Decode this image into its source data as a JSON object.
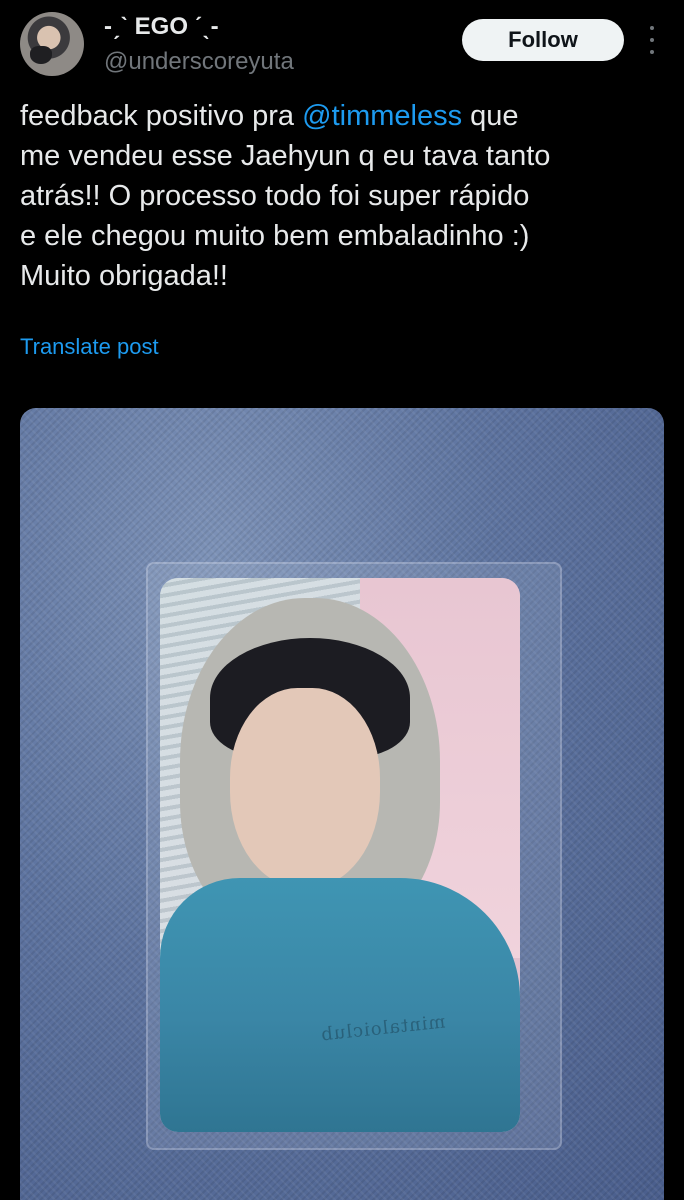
{
  "author": {
    "display_name": "-ˏˋ EGO ˊˎ-",
    "handle": "@underscoreyuta"
  },
  "actions": {
    "follow_label": "Follow",
    "more_icon": "more-vertical-icon"
  },
  "tweet": {
    "line1_before": "feedback positivo pra ",
    "mention": "@timmeless",
    "line1_after": " que",
    "line2": "me vendeu esse Jaehyun q eu tava tanto",
    "line3": "atrás!! O processo todo foi super rápido",
    "line4": "e ele chegou muito bem embaladinho :)",
    "line5": "Muito obrigada!!",
    "translate_label": "Translate post"
  },
  "media": {
    "photocard_print": "mintaloiclub"
  },
  "colors": {
    "background": "#000000",
    "text_primary": "#e7e9ea",
    "text_secondary": "#71767b",
    "accent": "#1d9bf0",
    "follow_bg": "#eff3f4"
  }
}
